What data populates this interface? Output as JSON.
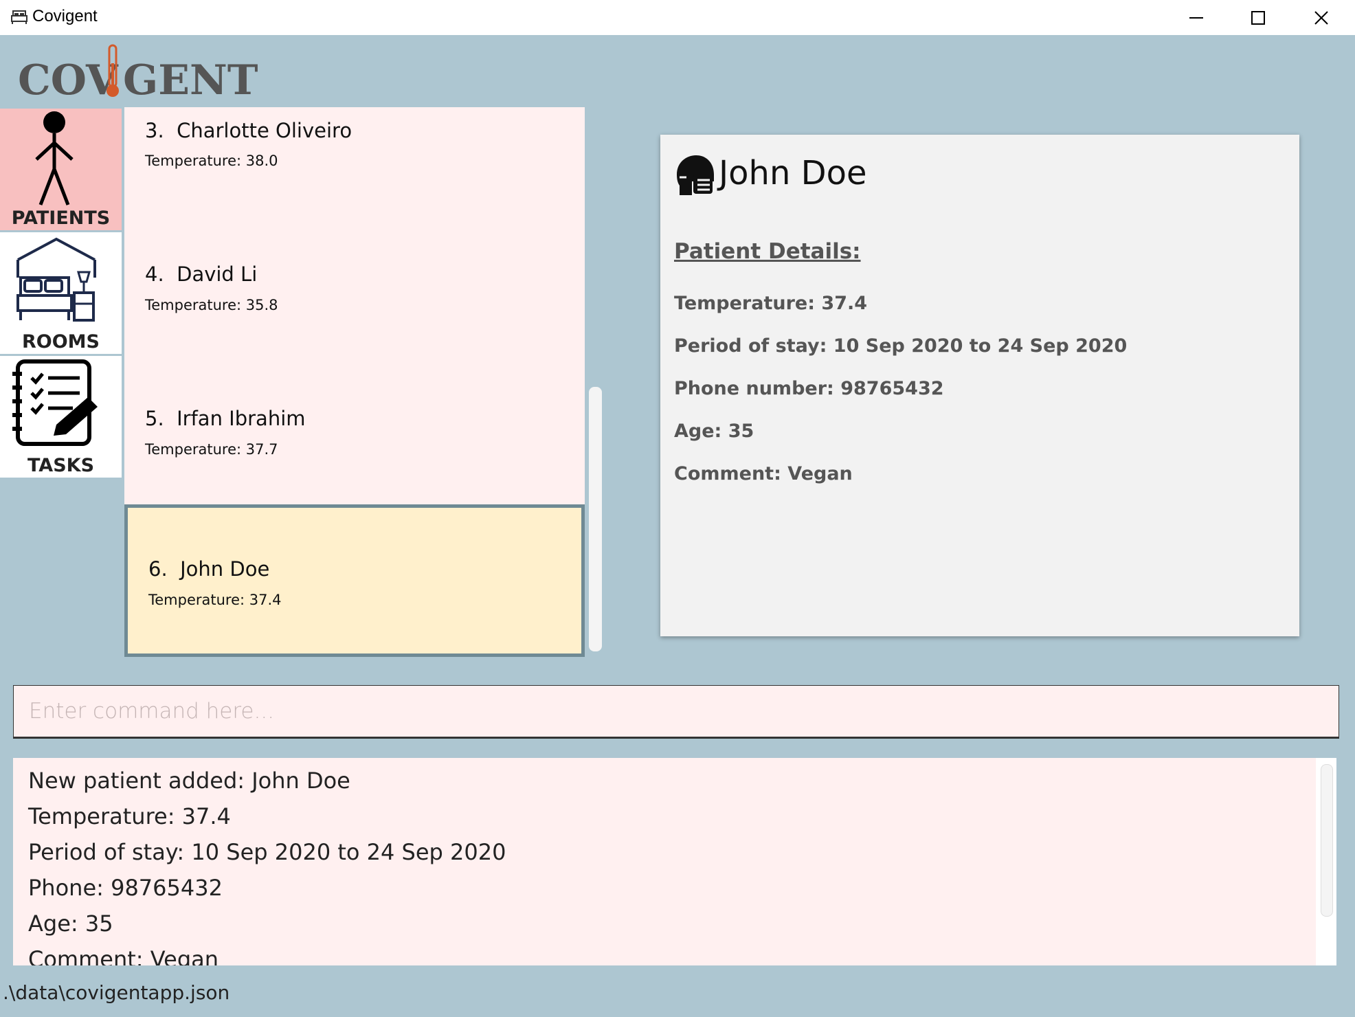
{
  "window": {
    "title": "Covigent"
  },
  "logo": {
    "text_left": "COV",
    "text_right": "GENT"
  },
  "nav": [
    {
      "label": "PATIENTS",
      "active": true
    },
    {
      "label": "ROOMS",
      "active": false
    },
    {
      "label": "TASKS",
      "active": false
    }
  ],
  "patients": [
    {
      "index": "3.",
      "name": "Charlotte Oliveiro",
      "temperature": "Temperature: 38.0"
    },
    {
      "index": "4.",
      "name": "David Li",
      "temperature": "Temperature: 35.8"
    },
    {
      "index": "5.",
      "name": "Irfan Ibrahim",
      "temperature": "Temperature: 37.7"
    },
    {
      "index": "6.",
      "name": "John Doe",
      "temperature": "Temperature: 37.4",
      "selected": true
    }
  ],
  "detail": {
    "name": "John Doe",
    "heading": "Patient Details:",
    "lines": [
      "Temperature: 37.4",
      "Period of stay: 10 Sep 2020 to 24 Sep 2020",
      "Phone number: 98765432",
      "Age: 35",
      "Comment: Vegan"
    ]
  },
  "command": {
    "placeholder": "Enter command here...",
    "value": ""
  },
  "result": {
    "lines": [
      "New patient added: John Doe",
      "Temperature: 37.4",
      "Period of stay: 10 Sep 2020 to 24 Sep 2020",
      "Phone: 98765432",
      "Age: 35",
      "Comment: Vegan"
    ]
  },
  "status": {
    "path": ".\\data\\covigentapp.json"
  },
  "icons": {
    "app": "bed-icon",
    "patients": "person-icon",
    "rooms": "bedroom-icon",
    "tasks": "checklist-icon",
    "detail": "masked-face-icon"
  },
  "colors": {
    "background": "#adc6d1",
    "nav_active": "#f8c0c0",
    "card": "#fff0f0",
    "card_selected": "#fff0cc",
    "logo_thermometer": "#d35a2a"
  }
}
